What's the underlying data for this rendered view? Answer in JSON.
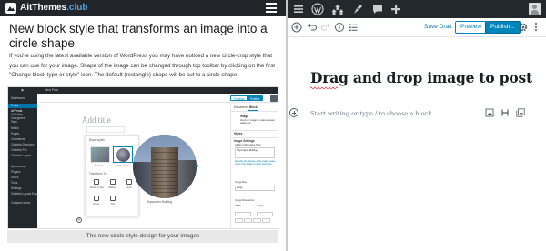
{
  "site": {
    "name_main": "AitThemes",
    "name_suffix": ".club"
  },
  "article": {
    "title": "New block style that transforms an image into a circle shape",
    "body": "If you're using the latest available version of WordPress you may have noticed a new circle-crop style that you can use for your image. Shape of the image can be changed through top toolbar by clicking on the first \"Change block type or style\" icon. The default (rectangle) shape will be cut to a circle shape.",
    "caption": "The new circle style design for your images"
  },
  "screenshot": {
    "topbar_site": "New Post",
    "sidebar_items": [
      "Dashboard",
      "Posts",
      "All Posts",
      "Add New",
      "Categories",
      "Tags",
      "Media",
      "Pages",
      "Comments",
      "Citadela Directory",
      "Citadela Pro",
      "Citadela Layout",
      "Appearance",
      "Plugins",
      "Users",
      "Tools",
      "Settings",
      "Citadela Layout Exporter",
      "Collapse menu"
    ],
    "preview_label": "Preview",
    "publish_label": "Publish",
    "add_title": "Add title",
    "block_styles_label": "Block styles",
    "style_default": "Default",
    "style_circle": "Circle mask",
    "transform_label": "Transform To:",
    "transform_items": [
      "Media & Text",
      "Gallery",
      "Cover",
      "Group",
      "File"
    ],
    "image_caption": "Skyscraper Building",
    "panel": {
      "tab_document": "Document",
      "tab_block": "Block",
      "block_name": "Image",
      "block_desc": "Insert an image to make a visual statement.",
      "styles": "Styles",
      "image_settings": "Image Settings",
      "alt_label": "Alt Text (Alternative Text)",
      "alt_value": "Skyscraper Building",
      "alt_help": "Describe the purpose of the image. Leave empty if the image is purely decorative.",
      "image_size": "Image Size",
      "size_value": "Large",
      "dimensions": "Image Dimensions",
      "width": "Width",
      "height": "Height"
    }
  },
  "editor": {
    "save_draft": "Save Draft",
    "preview": "Preview",
    "publish": "Publish...",
    "title": "Drag and drop image to post",
    "placeholder": "Start writing or type / to choose a block"
  },
  "colors": {
    "accent": "#0085ba",
    "admin_bar": "#23282d",
    "club": "#4fa3e0"
  }
}
